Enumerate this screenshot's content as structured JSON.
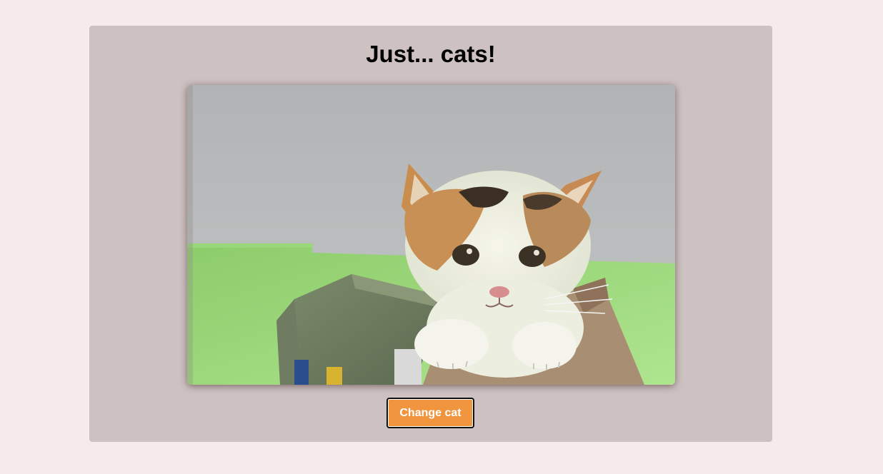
{
  "page": {
    "title": "Just... cats!"
  },
  "photo": {
    "subject": "cat-photo"
  },
  "actions": {
    "change_label": "Change cat"
  },
  "colors": {
    "page_background": "#f7eaea",
    "card_background": "#cdc1c1",
    "button_background": "#f0953d",
    "button_text": "#ffffff"
  }
}
